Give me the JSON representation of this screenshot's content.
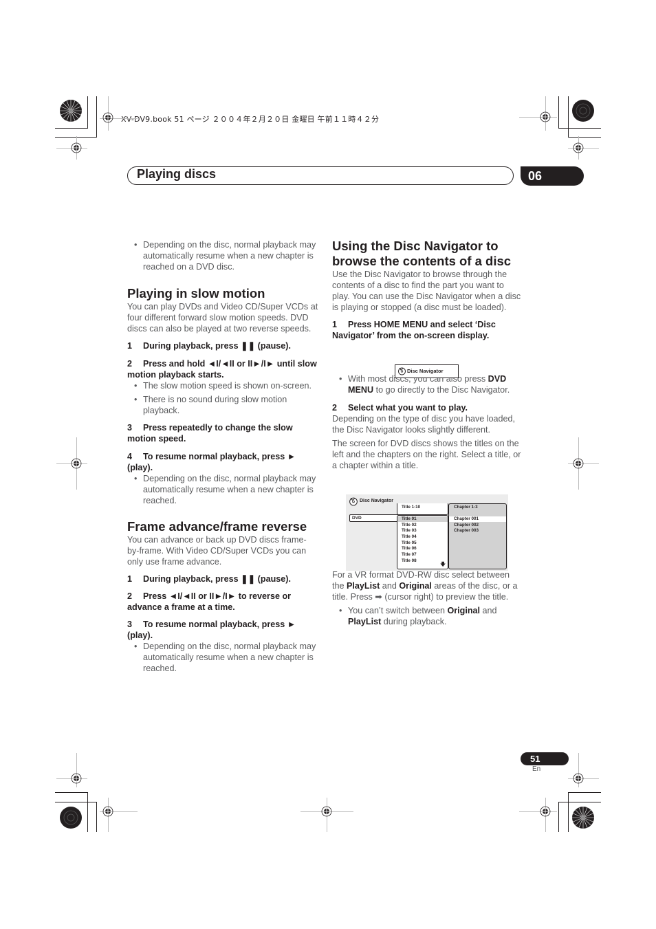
{
  "print_header": "XV-DV9.book  51 ページ  ２００４年２月２０日  金曜日  午前１１時４２分",
  "chapter": {
    "title": "Playing discs",
    "number": "06"
  },
  "left_column": {
    "intro_bullet": "Depending on the disc, normal playback may automatically resume when a new chapter is reached on a DVD disc.",
    "slow_motion": {
      "heading": "Playing in slow motion",
      "body": "You can play DVDs and Video CD/Super VCDs at four different forward slow motion speeds. DVD discs can also be played at two reverse speeds.",
      "steps": [
        {
          "num": "1",
          "text": "During playback, press ❚❚ (pause).",
          "bullets": []
        },
        {
          "num": "2",
          "text": "Press and hold ◄I/◄II or II►/I► until slow motion playback starts.",
          "bullets": [
            "The slow motion speed is shown on-screen.",
            "There is no sound during slow motion playback."
          ]
        },
        {
          "num": "3",
          "text": "Press repeatedly to change the slow motion speed.",
          "bullets": []
        },
        {
          "num": "4",
          "text": "To resume normal playback, press ► (play).",
          "bullets": [
            "Depending on the disc, normal playback may automatically resume when a new chapter is reached."
          ]
        }
      ]
    },
    "frame_advance": {
      "heading": "Frame advance/frame reverse",
      "body": "You can advance or back up DVD discs frame-by-frame. With Video CD/Super VCDs you can only use frame advance.",
      "steps": [
        {
          "num": "1",
          "text": "During playback, press ❚❚ (pause).",
          "bullets": []
        },
        {
          "num": "2",
          "text": "Press ◄I/◄II or II►/I► to reverse or advance a frame at a time.",
          "bullets": []
        },
        {
          "num": "3",
          "text": "To resume normal playback, press ► (play).",
          "bullets": [
            "Depending on the disc, normal playback may automatically resume when a new chapter is reached."
          ]
        }
      ]
    }
  },
  "right_column": {
    "heading": "Using the Disc Navigator to browse the contents of a disc",
    "body": "Use the Disc Navigator to browse through the contents of a disc to find the part you want to play. You can use the Disc Navigator when a disc is playing or stopped (a disc must be loaded).",
    "step1": {
      "num": "1",
      "text": "Press HOME MENU and select ‘Disc Navigator’ from the on-screen display."
    },
    "nav_button": {
      "icon": "disc-hand-icon",
      "label": "Disc Navigator"
    },
    "bullet1": {
      "pre": "With most discs, you can also press ",
      "bold": "DVD MENU",
      "post": " to go directly to the Disc Navigator."
    },
    "step2": {
      "num": "2",
      "text": "Select what you want to play."
    },
    "para1": "Depending on the type of disc you have loaded, the Disc Navigator looks slightly different.",
    "para2": "The screen for DVD discs shows the titles on the left and the chapters on the right. Select a title, or a chapter within a title.",
    "screen": {
      "title": "Disc Navigator",
      "source": "DVD",
      "titles_header": "Title 1-10",
      "titles": [
        "Title 01",
        "Title 02",
        "Title 03",
        "Title 04",
        "Title 05",
        "Title 06",
        "Title 07",
        "Title 08"
      ],
      "selected_title": "Title 01",
      "chapters_header": "Chapter 1-3",
      "chapters": [
        "Chapter 001",
        "Chapter 002",
        "Chapter 003"
      ],
      "selected_chapter": "Chapter 001",
      "scroll_icon": "down-arrow-icon",
      "colors": {
        "screen_bg": "#ececec",
        "chapter_panel": "#d2d2d2",
        "selected_title_bg": "#d2d2d2",
        "selected_chapter_bg": "#ffffff"
      }
    },
    "vr_para": {
      "t1": "For a VR format DVD-RW disc select between the ",
      "b1": "PlayList",
      "t2": " and ",
      "b2": "Original",
      "t3": " areas of the disc, or a title. Press ➡ (cursor right) to preview the title."
    },
    "bullet2": {
      "t1": "You can’t switch between ",
      "b1": "Original",
      "t2": " and ",
      "b2": "PlayList",
      "t3": " during playback."
    }
  },
  "footer": {
    "page_number": "51",
    "language": "En"
  },
  "colors": {
    "text_dark": "#231f20",
    "text_body": "#58595b",
    "tab_fill": "#231f20"
  }
}
